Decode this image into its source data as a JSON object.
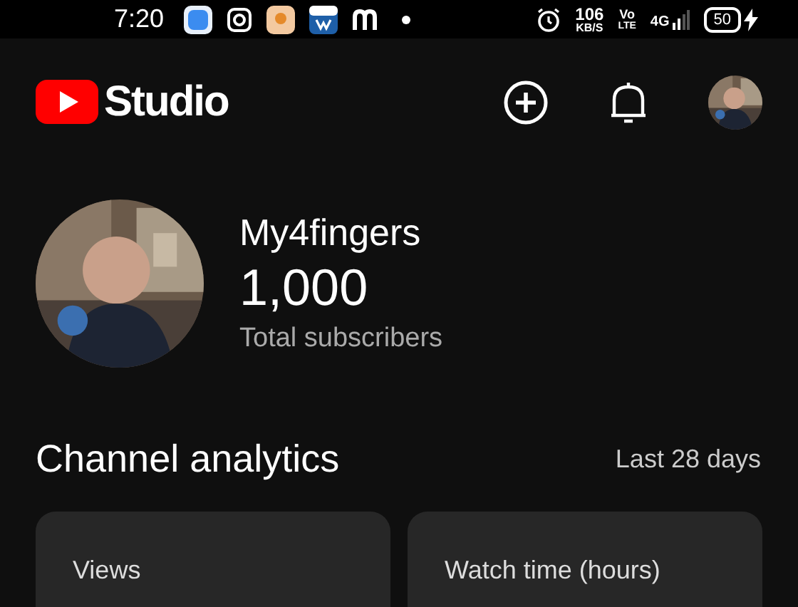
{
  "status_bar": {
    "time": "7:20",
    "speed": "106",
    "speed_unit": "KB/S",
    "volte": "Vo",
    "volte_sub": "LTE",
    "network": "4G",
    "battery": "50"
  },
  "header": {
    "title": "Studio"
  },
  "channel": {
    "name": "My4fingers",
    "subscribers": "1,000",
    "subscribers_label": "Total subscribers"
  },
  "analytics": {
    "title": "Channel analytics",
    "period": "Last 28 days"
  },
  "cards": [
    {
      "label": "Views"
    },
    {
      "label": "Watch time (hours)"
    }
  ]
}
